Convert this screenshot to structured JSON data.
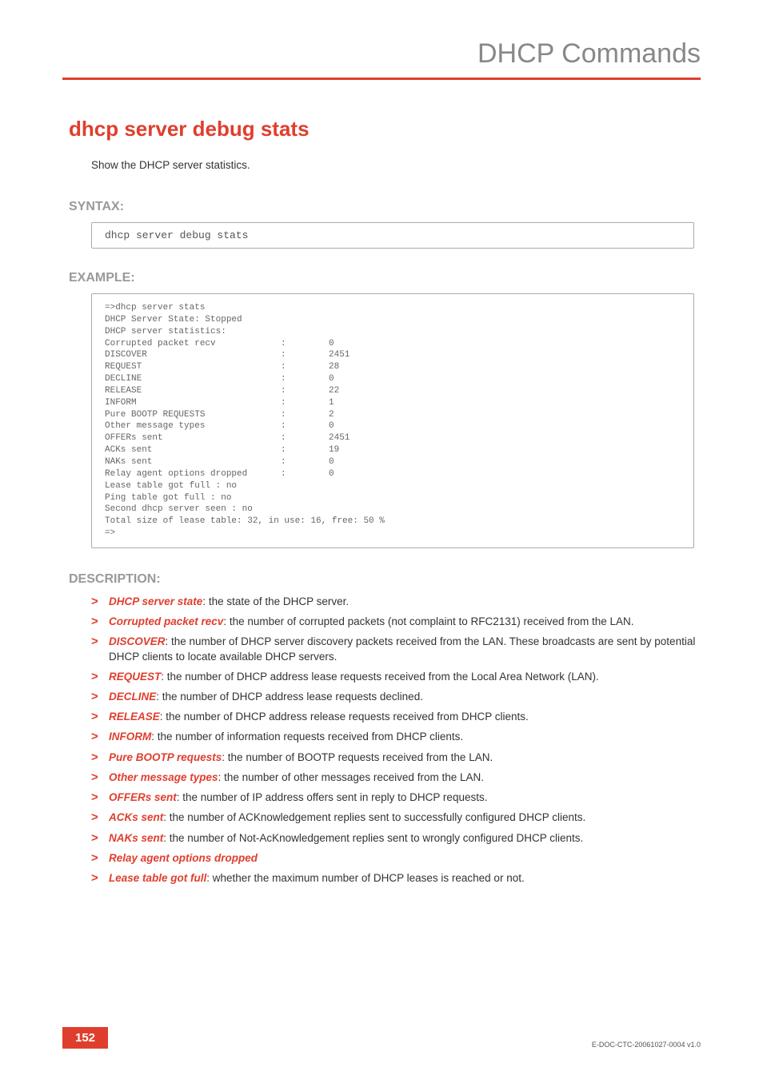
{
  "header": {
    "title": "DHCP Commands"
  },
  "command": {
    "title": "dhcp server debug stats",
    "summary": "Show the DHCP server statistics."
  },
  "syntax": {
    "label": "SYNTAX:",
    "code": "dhcp server debug stats"
  },
  "example": {
    "label": "EXAMPLE:",
    "prompt_line": "=>dhcp server stats",
    "state_line": "DHCP Server State:   Stopped",
    "stats_header": "DHCP server statistics:",
    "rows": [
      {
        "label": "Corrupted packet recv",
        "value": "0"
      },
      {
        "label": "DISCOVER",
        "value": "2451"
      },
      {
        "label": "REQUEST",
        "value": "28"
      },
      {
        "label": "DECLINE",
        "value": "0"
      },
      {
        "label": "RELEASE",
        "value": "22"
      },
      {
        "label": "INFORM",
        "value": "1"
      },
      {
        "label": "Pure BOOTP REQUESTS",
        "value": "2"
      },
      {
        "label": "Other message types",
        "value": "0"
      },
      {
        "label": "OFFERs sent",
        "value": "2451"
      },
      {
        "label": "ACKs sent",
        "value": "19"
      },
      {
        "label": "NAKs sent",
        "value": "0"
      },
      {
        "label": "Relay agent options dropped",
        "value": "0"
      }
    ],
    "tail": [
      "Lease table got full    : no",
      "Ping table got full     : no",
      "Second dhcp server seen : no",
      "Total size of lease table: 32, in use: 16, free: 50 %",
      "=>"
    ]
  },
  "description": {
    "label": "DESCRIPTION:",
    "items": [
      {
        "term": "DHCP server state",
        "text": ": the state of the DHCP server."
      },
      {
        "term": "Corrupted packet recv",
        "text": ": the number of corrupted packets (not complaint to RFC2131) received from the LAN."
      },
      {
        "term": "DISCOVER",
        "text": ": the number of DHCP server discovery packets received from the LAN. These broadcasts are sent by potential DHCP clients to locate available DHCP servers."
      },
      {
        "term": "REQUEST",
        "text": ": the number of DHCP address lease requests received from the Local Area Network (LAN)."
      },
      {
        "term": "DECLINE",
        "text": ": the number of DHCP address lease requests declined."
      },
      {
        "term": "RELEASE",
        "text": ": the number of DHCP address release requests received from DHCP clients."
      },
      {
        "term": "INFORM",
        "text": ": the number of information requests received from DHCP clients."
      },
      {
        "term": "Pure BOOTP requests",
        "text": ": the number of BOOTP requests received from the LAN."
      },
      {
        "term": "Other message types",
        "text": ": the number of other messages received from the LAN."
      },
      {
        "term": "OFFERs sent",
        "text": ": the number of IP address offers sent in reply to DHCP requests."
      },
      {
        "term": "ACKs sent",
        "text": ": the number of ACKnowledgement replies sent to successfully configured DHCP clients."
      },
      {
        "term": "NAKs sent",
        "text": ": the number of Not-AcKnowledgement replies sent to wrongly configured DHCP clients."
      },
      {
        "term": "Relay agent options dropped",
        "text": ""
      },
      {
        "term": "Lease table got full",
        "text": ": whether the maximum number of DHCP leases is reached or not."
      }
    ]
  },
  "footer": {
    "page": "152",
    "docid": "E-DOC-CTC-20061027-0004 v1.0"
  }
}
